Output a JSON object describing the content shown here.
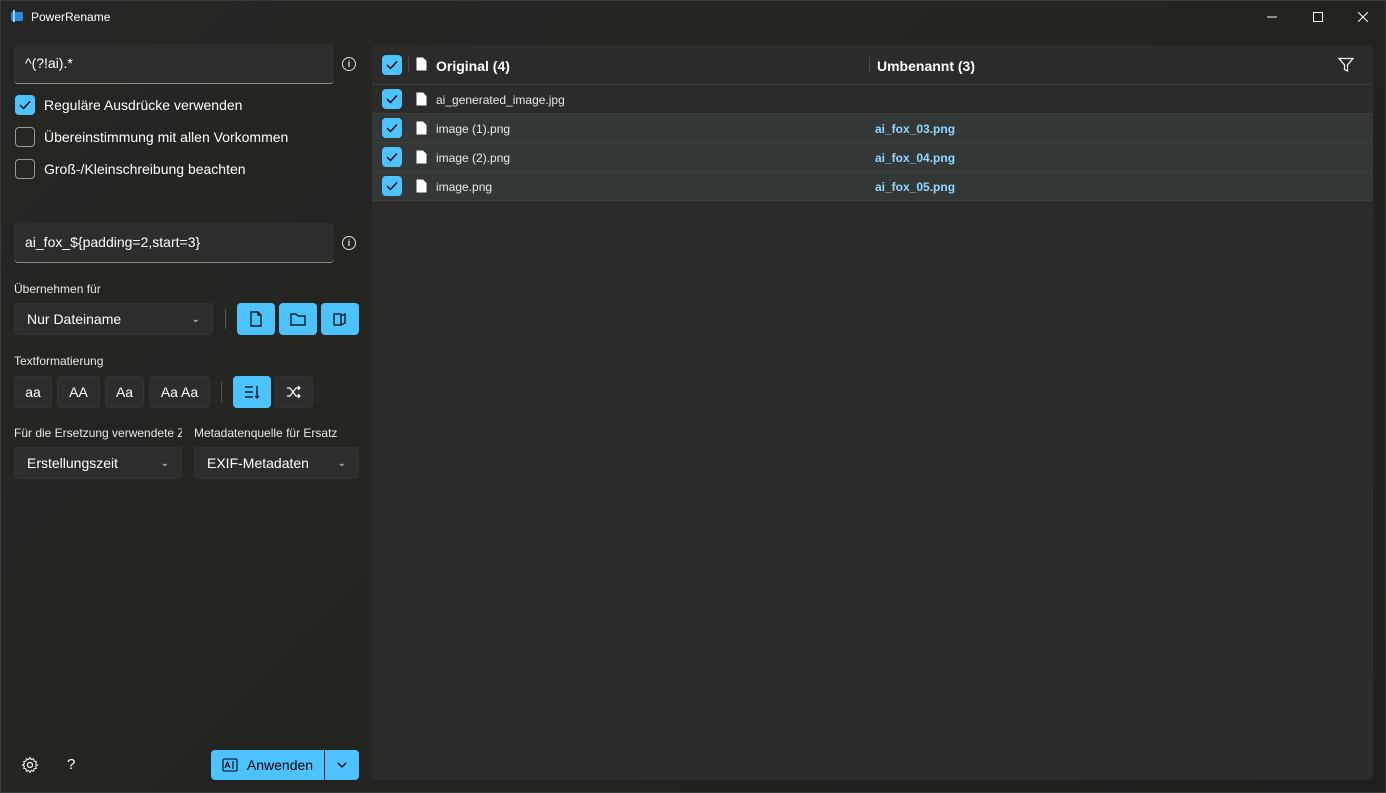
{
  "window": {
    "title": "PowerRename",
    "accent": "#4cc2ff"
  },
  "search": {
    "value": "^(?!ai).*"
  },
  "options": {
    "regex_label": "Reguläre Ausdrücke verwenden",
    "regex_checked": true,
    "match_all_label": "Übereinstimmung mit allen Vorkommen",
    "match_all_checked": false,
    "case_label": "Groß-/Kleinschreibung beachten",
    "case_checked": false
  },
  "replace": {
    "value": "ai_fox_${padding=2,start=3}"
  },
  "apply_to": {
    "label": "Übernehmen für",
    "selected": "Nur Dateiname"
  },
  "text_format": {
    "label": "Textformatierung",
    "lowercase": "aa",
    "uppercase": "AA",
    "titlecase": "Aa",
    "capitalize": "Aa Aa"
  },
  "time_source": {
    "label": "Für die Ersetzung verwendete Z",
    "selected": "Erstellungszeit"
  },
  "metadata_source": {
    "label": "Metadatenquelle für Ersatz",
    "selected": "EXIF-Metadaten"
  },
  "footer": {
    "help": "?",
    "apply_label": "Anwenden"
  },
  "list": {
    "original_header": "Original (4)",
    "renamed_header": "Umbenannt (3)",
    "rows": [
      {
        "original": "ai_generated_image.jpg",
        "renamed": "",
        "checked": true
      },
      {
        "original": "image (1).png",
        "renamed": "ai_fox_03.png",
        "checked": true
      },
      {
        "original": "image (2).png",
        "renamed": "ai_fox_04.png",
        "checked": true
      },
      {
        "original": "image.png",
        "renamed": "ai_fox_05.png",
        "checked": true
      }
    ]
  }
}
